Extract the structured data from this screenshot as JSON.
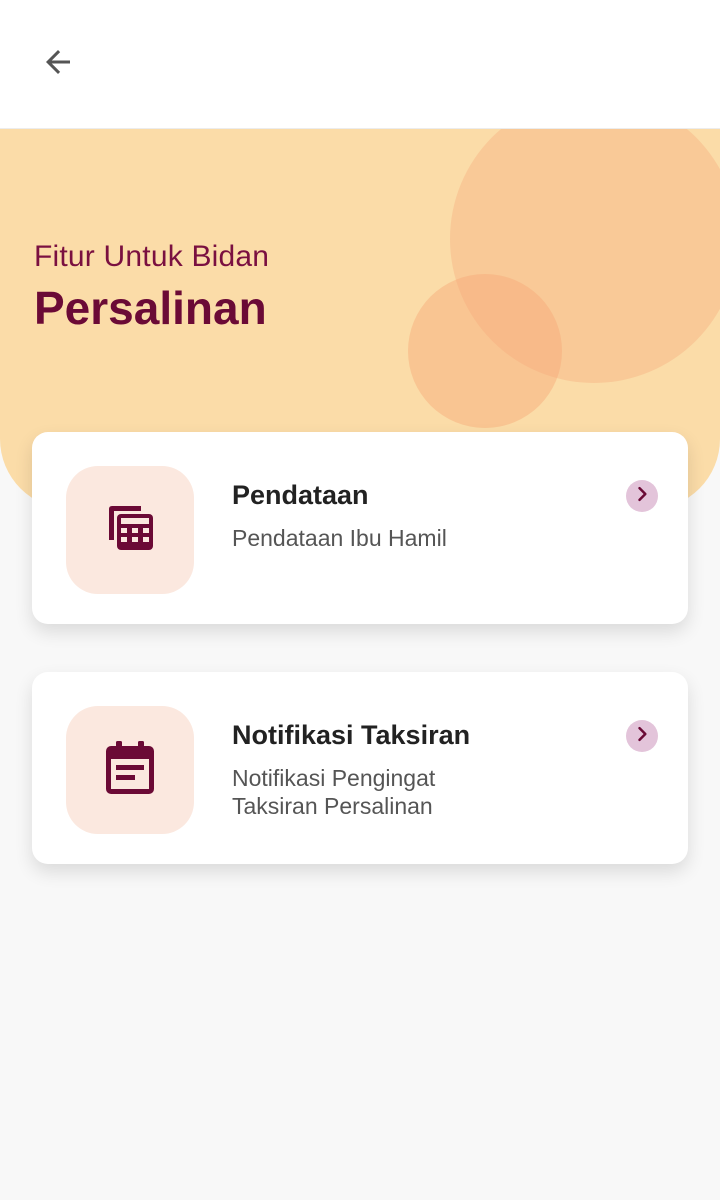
{
  "header": {
    "back_icon": "arrow-left-icon"
  },
  "hero": {
    "subtitle": "Fitur Untuk Bidan",
    "title": "Persalinan",
    "background_color": "#fbdca8",
    "accent_color": "#6b0a36"
  },
  "features": [
    {
      "icon": "calculator-icon",
      "title": "Pendataan",
      "description": "Pendataan Ibu Hamil"
    },
    {
      "icon": "calendar-event-icon",
      "title": "Notifikasi Taksiran",
      "description_line1": "Notifikasi Pengingat",
      "description_line2": "Taksiran Persalinan"
    }
  ]
}
